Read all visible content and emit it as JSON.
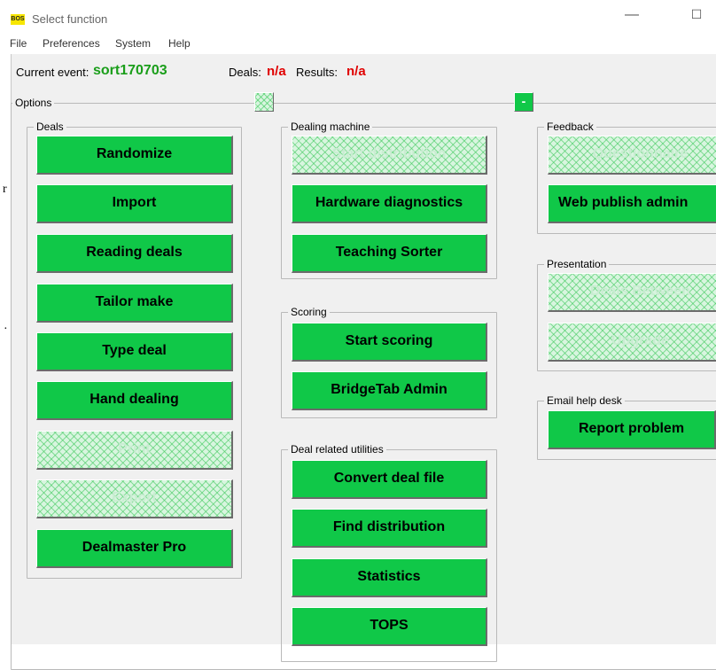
{
  "window": {
    "logo": "BOS",
    "title": "Select function",
    "minimize": "—",
    "maximize": "☐"
  },
  "menu": [
    "File",
    "Preferences",
    "System",
    "Help"
  ],
  "info": {
    "event_label": "Current event:",
    "event_value": "sort170703",
    "deals_label": "Deals:",
    "deals_value": "n/a",
    "results_label": "Results:",
    "results_value": "n/a"
  },
  "options": {
    "label": "Options",
    "collapse_label": "-"
  },
  "stray": [
    "r",
    "·"
  ],
  "groups": {
    "deals": {
      "label": "Deals",
      "buttons": [
        "Randomize",
        "Import",
        "Reading deals",
        "Tailor make",
        "Type deal",
        "Hand dealing",
        "Print",
        "Export",
        "Dealmaster Pro"
      ]
    },
    "dealing_machine": {
      "label": "Dealing machine",
      "buttons": [
        "Start distribution",
        "Hardware diagnostics",
        "Teaching Sorter"
      ]
    },
    "scoring": {
      "label": "Scoring",
      "buttons": [
        "Start scoring",
        "BridgeTab Admin"
      ]
    },
    "deal_utils": {
      "label": "Deal related utilities",
      "buttons": [
        "Convert deal file",
        "Find distribution",
        "Statistics",
        "TOPS"
      ]
    },
    "feedback": {
      "label": "Feedback",
      "buttons": [
        "Questionnaire",
        "Web publish admin"
      ]
    },
    "presentation": {
      "label": "Presentation",
      "buttons": [
        "Deals Between",
        "Upgrade"
      ]
    },
    "email": {
      "label": "Email help desk",
      "buttons": [
        "Report problem"
      ]
    }
  }
}
